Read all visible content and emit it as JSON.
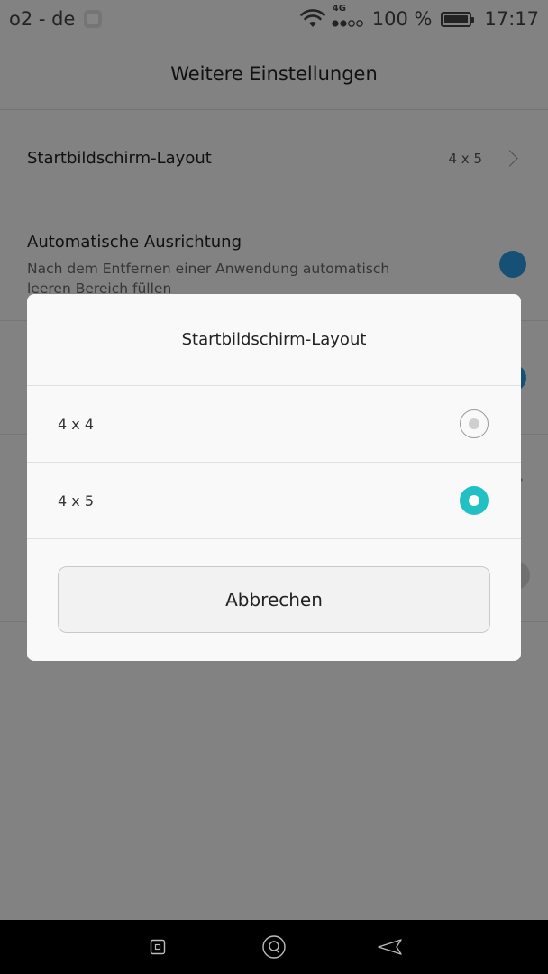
{
  "status_bar": {
    "carrier": "o2 - de",
    "network_type": "4G",
    "battery": "100 %",
    "time": "17:17",
    "icons": [
      "notification-icon",
      "wifi-icon",
      "signal-icon",
      "battery-icon"
    ]
  },
  "header": {
    "title": "Weitere Einstellungen"
  },
  "settings": {
    "layout": {
      "label": "Startbildschirm-Layout",
      "value": "4 x 5"
    },
    "auto_align": {
      "label": "Automatische Ausrichtung",
      "description": "Nach dem Entfernen einer Anwendung automatisch leeren Bereich füllen",
      "enabled": true
    }
  },
  "dialog": {
    "title": "Startbildschirm-Layout",
    "options": [
      {
        "label": "4 x 4",
        "selected": false
      },
      {
        "label": "4 x 5",
        "selected": true
      }
    ],
    "cancel_label": "Abbrechen"
  },
  "nav_bar": {
    "icons": [
      "recent-apps-icon",
      "home-icon",
      "back-icon"
    ]
  },
  "colors": {
    "accent_radio": "#20c0c4",
    "toggle_on": "#2b9be0"
  }
}
